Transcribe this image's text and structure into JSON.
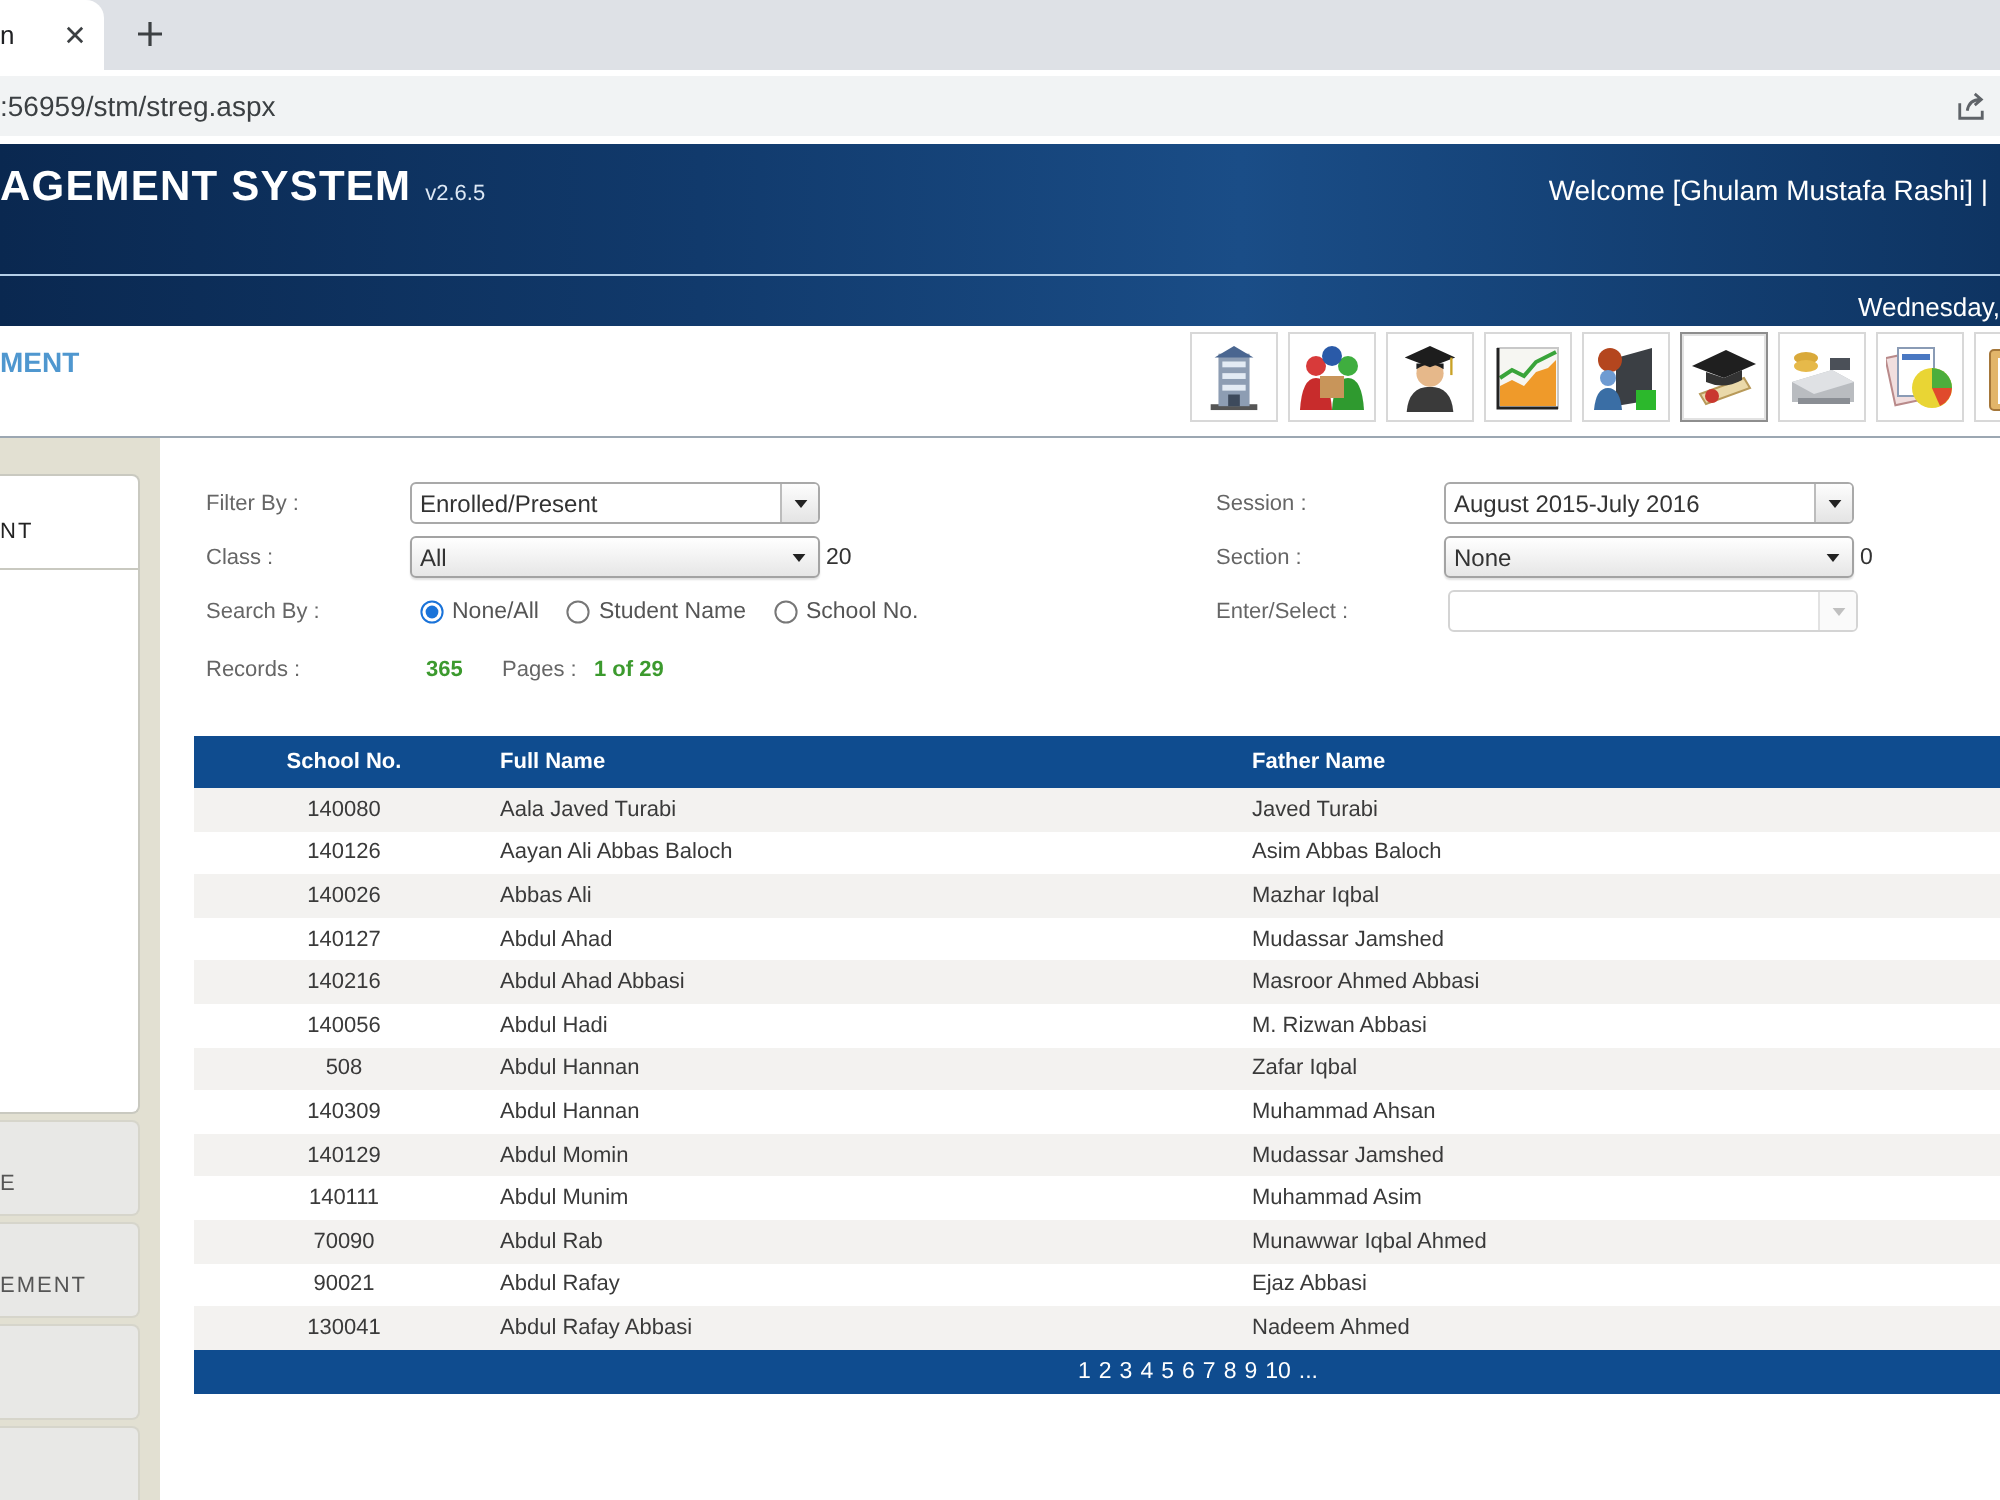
{
  "browser": {
    "tab": {
      "title": "n"
    },
    "address": ":56959/stm/streg.aspx"
  },
  "header": {
    "title": "AGEMENT SYSTEM",
    "version": "v2.6.5",
    "welcome": "Welcome [Ghulam Mustafa Rashi] |",
    "date": "Wednesday,"
  },
  "module": {
    "title": "MENT"
  },
  "toolbar": [
    {
      "kind": "building",
      "selected": false
    },
    {
      "kind": "people",
      "selected": false
    },
    {
      "kind": "graduate",
      "selected": false
    },
    {
      "kind": "chart",
      "selected": false
    },
    {
      "kind": "presenter",
      "selected": false
    },
    {
      "kind": "diploma",
      "selected": true
    },
    {
      "kind": "cash",
      "selected": false
    },
    {
      "kind": "report",
      "selected": false
    },
    {
      "kind": "clipboard",
      "selected": false
    }
  ],
  "sidebar": {
    "sections": [
      {
        "label": "NT",
        "expanded": true
      },
      {
        "label": "E",
        "expanded": false
      },
      {
        "label": "EMENT",
        "expanded": false
      },
      {
        "expanded": false
      },
      {
        "expanded": false
      }
    ]
  },
  "filters": {
    "left": [
      {
        "kind": "combo",
        "label": "Filter By :",
        "value": "Enrolled/Present",
        "disabled": false
      },
      {
        "kind": "select",
        "label": "Class :",
        "value": "All",
        "count": "20",
        "disabled": false
      },
      {
        "kind": "radio",
        "label": "Search By :",
        "options": [
          {
            "label": "None/All",
            "selected": true
          },
          {
            "label": "Student Name",
            "selected": false
          },
          {
            "label": "School No.",
            "selected": false
          }
        ]
      }
    ],
    "right": [
      {
        "kind": "combo",
        "label": "Session :",
        "value": "August 2015-July 2016",
        "disabled": false
      },
      {
        "kind": "select",
        "label": "Section :",
        "value": "None",
        "count": "0",
        "disabled": false
      },
      {
        "kind": "combo",
        "label": "Enter/Select :",
        "disabled": true
      }
    ]
  },
  "summary": {
    "records_label": "Records :",
    "records": "365",
    "pages_label": "Pages :",
    "pages": "1 of 29"
  },
  "table": {
    "columns": [
      "School No.",
      "Full Name",
      "Father Name"
    ],
    "rows": [
      [
        "140080",
        "Aala Javed Turabi",
        "Javed Turabi"
      ],
      [
        "140126",
        "Aayan Ali Abbas Baloch",
        "Asim Abbas Baloch"
      ],
      [
        "140026",
        "Abbas Ali",
        "Mazhar Iqbal"
      ],
      [
        "140127",
        "Abdul Ahad",
        "Mudassar Jamshed"
      ],
      [
        "140216",
        "Abdul Ahad Abbasi",
        "Masroor Ahmed Abbasi"
      ],
      [
        "140056",
        "Abdul Hadi",
        "M. Rizwan Abbasi"
      ],
      [
        "508",
        "Abdul Hannan",
        "Zafar Iqbal"
      ],
      [
        "140309",
        "Abdul Hannan",
        "Muhammad Ahsan"
      ],
      [
        "140129",
        "Abdul Momin",
        "Mudassar Jamshed"
      ],
      [
        "140111",
        "Abdul Munim",
        "Muhammad Asim"
      ],
      [
        "70090",
        "Abdul Rab",
        "Munawwar Iqbal Ahmed"
      ],
      [
        "90021",
        "Abdul Rafay",
        "Ejaz Abbasi"
      ],
      [
        "130041",
        "Abdul Rafay Abbasi",
        "Nadeem Ahmed"
      ]
    ],
    "pager": [
      "1",
      "2",
      "3",
      "4",
      "5",
      "6",
      "7",
      "8",
      "9",
      "10",
      "..."
    ]
  }
}
